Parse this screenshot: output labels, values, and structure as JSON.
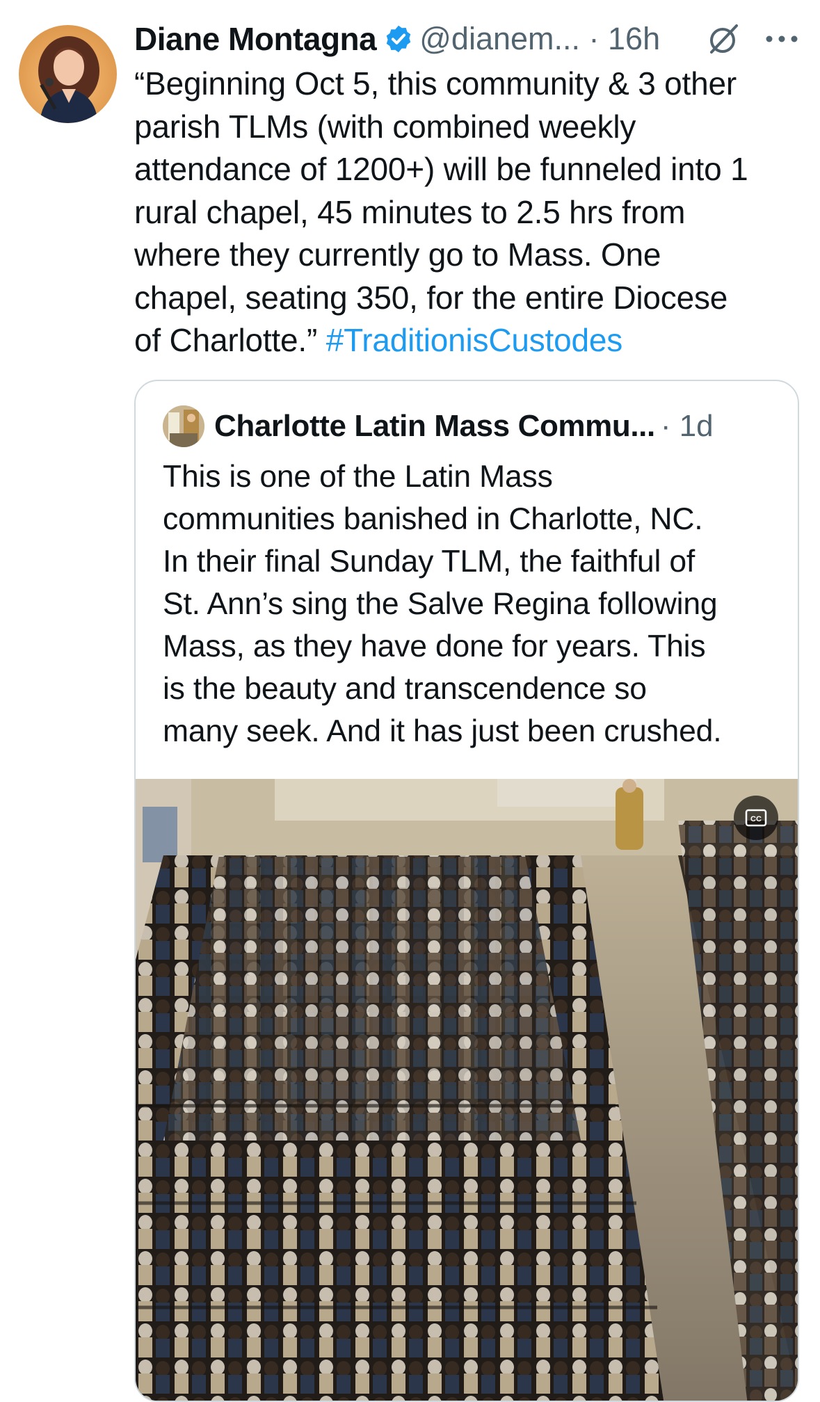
{
  "tweet": {
    "author_name": "Diane Montagna",
    "handle_time": "@dianem... · 16h",
    "text": "“Beginning Oct 5, this community & 3 other\nparish TLMs (with combined weekly\nattendance of 1200+) will be funneled into 1\nrural chapel, 45 minutes to 2.5 hrs from\nwhere they currently go to Mass. One\nchapel, seating 350, for the entire Diocese\nof Charlotte.” ",
    "hashtag": "#TraditionisCustodes",
    "avatar_icon": "profile-photo",
    "verified_icon": "verified-badge-icon",
    "grok_icon": "grok-icon",
    "more_icon": "more-dots-icon"
  },
  "quoted": {
    "author_name": "Charlotte Latin Mass Commu...",
    "time": "· 1d",
    "text": "This is one of the Latin Mass\ncommunities banished in Charlotte, NC.\nIn their final Sunday TLM, the faithful of\nSt. Ann’s sing the Salve Regina following\nMass, as they have done for years. This\nis the beauty and transcendence so\nmany seek. And it has just been crushed.",
    "media_kind": "video",
    "cc_icon": "closed-captions-icon"
  },
  "colors": {
    "text": "#0f1419",
    "secondary": "#536471",
    "link": "#1d9bf0",
    "border": "#cfd9de"
  }
}
